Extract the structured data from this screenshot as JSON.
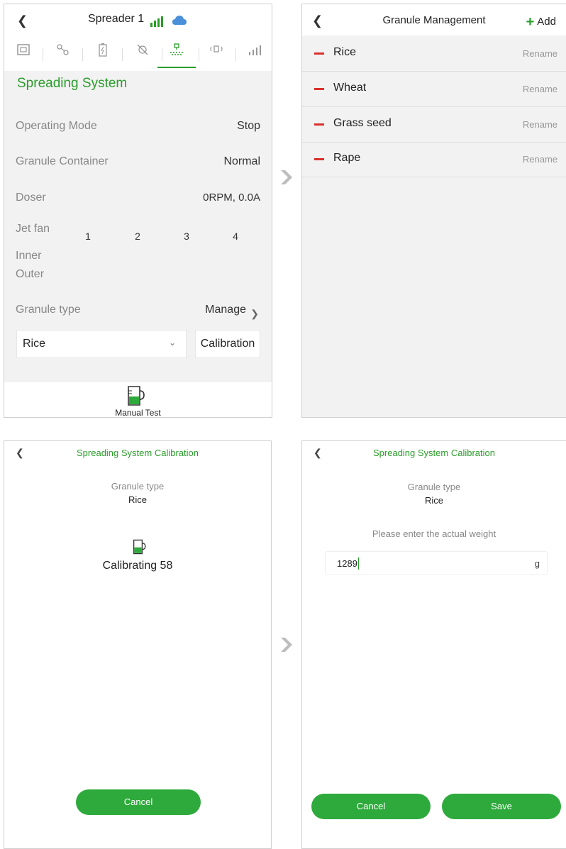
{
  "spreader_panel": {
    "title": "Spreader 1",
    "section_title": "Spreading System",
    "rows": [
      {
        "label": "Operating Mode",
        "value": "Stop"
      },
      {
        "label": "Granule Container",
        "value": "Normal"
      },
      {
        "label": "Doser",
        "value": "0RPM, 0.0A"
      }
    ],
    "jet_fan": {
      "label": "Jet fan",
      "columns": [
        "1",
        "2",
        "3",
        "4"
      ],
      "inner_label": "Inner",
      "outer_label": "Outer"
    },
    "granule_type_label": "Granule type",
    "manage_label": "Manage",
    "granule_selected": "Rice",
    "calibration_label": "Calibration",
    "manual_test_label": "Manual Test"
  },
  "granule_management": {
    "title": "Granule Management",
    "add_label": "Add",
    "items": [
      {
        "name": "Rice",
        "action": "Rename"
      },
      {
        "name": "Wheat",
        "action": "Rename"
      },
      {
        "name": "Grass seed",
        "action": "Rename"
      },
      {
        "name": "Rape",
        "action": "Rename"
      }
    ]
  },
  "calibration_progress": {
    "title": "Spreading System Calibration",
    "granule_type_label": "Granule type",
    "granule_type_value": "Rice",
    "status": "Calibrating 58",
    "cancel_label": "Cancel"
  },
  "calibration_weight": {
    "title": "Spreading System Calibration",
    "granule_type_label": "Granule type",
    "granule_type_value": "Rice",
    "prompt": "Please enter the actual weight",
    "weight_value": "1289",
    "unit": "g",
    "cancel_label": "Cancel",
    "save_label": "Save"
  },
  "colors": {
    "accent": "#2a9d2a",
    "button": "#2eaa3c",
    "remove": "#d9302c"
  }
}
